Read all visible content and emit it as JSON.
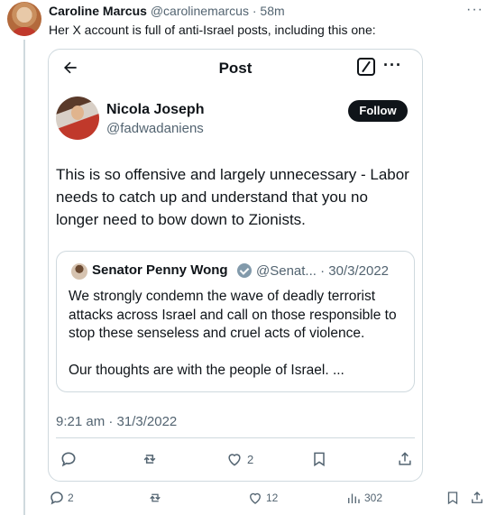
{
  "tweet": {
    "author_name": "Caroline Marcus",
    "author_handle": "@carolinemarcus",
    "time": "· 58m",
    "text": "Her X account is full of anti-Israel posts, including this one:"
  },
  "embedded_post": {
    "title": "Post",
    "author_name": "Nicola Joseph",
    "author_handle": "@fadwadaniens",
    "follow_label": "Follow",
    "text": "This is so offensive and largely unnecessary - Labor needs to catch up and understand that you no longer need to bow down to Zionists.",
    "quote": {
      "author_name": "Senator Penny Wong",
      "author_handle": "@Senat...",
      "date": "· 30/3/2022",
      "paragraph1": "We strongly condemn the wave of deadly terrorist attacks across Israel and call on those responsible to stop these senseless and cruel acts of violence.",
      "paragraph2": "Our thoughts are with the people of Israel. ..."
    },
    "timestamp": "9:21 am · 31/3/2022",
    "actions": {
      "reply_icon": "reply-icon",
      "retweet_icon": "retweet-icon",
      "like_icon": "heart-icon",
      "like_count": "2",
      "bookmark_icon": "bookmark-icon",
      "share_icon": "share-icon"
    }
  },
  "outer_actions": {
    "reply_count": "2",
    "like_count": "12",
    "view_count": "302"
  },
  "colors": {
    "text": "#0f1419",
    "secondary": "#536471",
    "border": "#cfd9de",
    "follow_bg": "#0f1419"
  }
}
